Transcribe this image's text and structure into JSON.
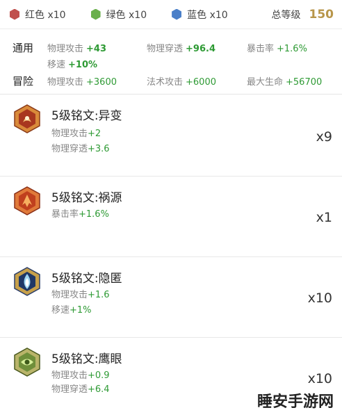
{
  "colors": [
    {
      "label": "红色 x10",
      "hex": "#c0504d",
      "icon": "red-hex-icon"
    },
    {
      "label": "绿色 x10",
      "hex": "#6ab04c",
      "icon": "green-hex-icon"
    },
    {
      "label": "蓝色 x10",
      "hex": "#4a7fc8",
      "icon": "blue-hex-icon"
    }
  ],
  "level": {
    "label": "总等级",
    "value": "150"
  },
  "stats": {
    "general_label": "通用",
    "adventure_label": "冒险",
    "general": [
      {
        "name": "物理攻击",
        "value": "+43"
      },
      {
        "name": "物理穿透",
        "value": "+96.4"
      },
      {
        "name": "暴击率",
        "value": "+1.6%"
      },
      {
        "name": "移速",
        "value": "+10%"
      }
    ],
    "adventure": [
      {
        "name": "物理攻击",
        "value": "+3600"
      },
      {
        "name": "法术攻击",
        "value": "+6000"
      },
      {
        "name": "最大生命",
        "value": "+56700"
      }
    ]
  },
  "runes": [
    {
      "name": "5级铭文:异变",
      "icon": "rune-yibian-icon",
      "count": "x9",
      "attrs": [
        {
          "name": "物理攻击",
          "value": "+2"
        },
        {
          "name": "物理穿透",
          "value": "+3.6"
        }
      ]
    },
    {
      "name": "5级铭文:祸源",
      "icon": "rune-huoyuan-icon",
      "count": "x1",
      "attrs": [
        {
          "name": "暴击率",
          "value": "+1.6%"
        }
      ]
    },
    {
      "name": "5级铭文:隐匿",
      "icon": "rune-yinni-icon",
      "count": "x10",
      "attrs": [
        {
          "name": "物理攻击",
          "value": "+1.6"
        },
        {
          "name": "移速",
          "value": "+1%"
        }
      ]
    },
    {
      "name": "5级铭文:鹰眼",
      "icon": "rune-yingyan-icon",
      "count": "x10",
      "attrs": [
        {
          "name": "物理攻击",
          "value": "+0.9"
        },
        {
          "name": "物理穿透",
          "value": "+6.4"
        }
      ]
    }
  ],
  "watermark": "睡安手游网"
}
